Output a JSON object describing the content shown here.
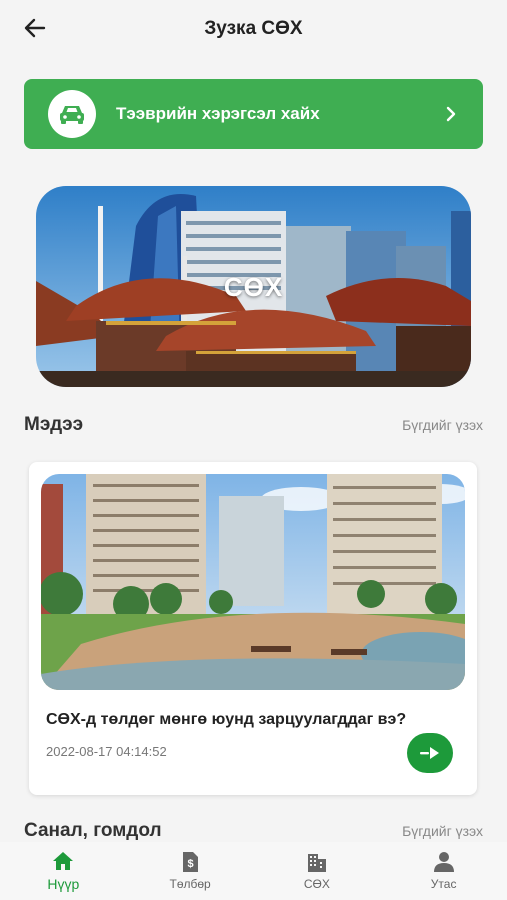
{
  "header": {
    "title": "Зузка СӨХ"
  },
  "vehicle_search": {
    "label": "Тээврийн хэрэгсэл хайх"
  },
  "hero": {
    "overlay_text": "СӨХ"
  },
  "news": {
    "title": "Мэдээ",
    "see_all": "Бүгдийг үзэх",
    "items": [
      {
        "title": "СӨХ-д төлдөг мөнгө юунд зарцуулагддаг вэ?",
        "date": "2022-08-17 04:14:52"
      }
    ]
  },
  "feedback": {
    "title": "Санал, гомдол",
    "see_all": "Бүгдийг үзэх"
  },
  "bottom_nav": {
    "items": [
      {
        "label": "Нүүр",
        "icon": "home-icon",
        "active": true
      },
      {
        "label": "Төлбөр",
        "icon": "bill-icon",
        "active": false
      },
      {
        "label": "СӨХ",
        "icon": "building-icon",
        "active": false
      },
      {
        "label": "Утас",
        "icon": "person-icon",
        "active": false
      }
    ]
  },
  "colors": {
    "primary_green": "#3fae52",
    "active_green": "#1d9a3a"
  }
}
